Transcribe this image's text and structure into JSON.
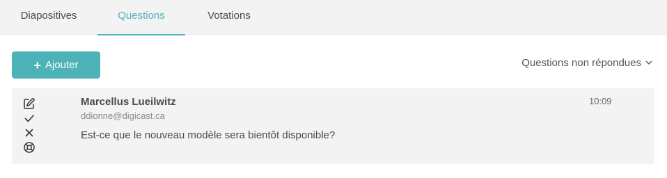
{
  "tabs": [
    {
      "label": "Diapositives",
      "active": false
    },
    {
      "label": "Questions",
      "active": true
    },
    {
      "label": "Votations",
      "active": false
    }
  ],
  "toolbar": {
    "add_label": "Ajouter",
    "add_icon": "plus-icon",
    "filter_label": "Questions non répondues",
    "filter_icon": "chevron-down-icon"
  },
  "question": {
    "author": "Marcellus Lueilwitz",
    "email": "ddionne@digicast.ca",
    "text": "Est-ce que le nouveau modèle sera bientôt disponible?",
    "time": "10:09",
    "actions": [
      "edit-icon",
      "check-icon",
      "close-icon",
      "lifebuoy-icon"
    ]
  },
  "colors": {
    "accent": "#4db3b9",
    "tabbar_bg": "#f3f3f3",
    "card_bg": "#f3f3f3"
  }
}
